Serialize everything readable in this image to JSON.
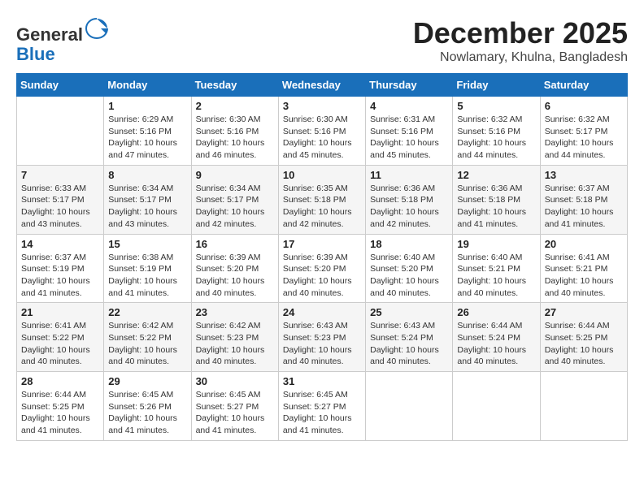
{
  "header": {
    "logo_general": "General",
    "logo_blue": "Blue",
    "month_title": "December 2025",
    "location": "Nowlamary, Khulna, Bangladesh"
  },
  "weekdays": [
    "Sunday",
    "Monday",
    "Tuesday",
    "Wednesday",
    "Thursday",
    "Friday",
    "Saturday"
  ],
  "weeks": [
    [
      {
        "day": "",
        "sunrise": "",
        "sunset": "",
        "daylight": ""
      },
      {
        "day": "1",
        "sunrise": "Sunrise: 6:29 AM",
        "sunset": "Sunset: 5:16 PM",
        "daylight": "Daylight: 10 hours and 47 minutes."
      },
      {
        "day": "2",
        "sunrise": "Sunrise: 6:30 AM",
        "sunset": "Sunset: 5:16 PM",
        "daylight": "Daylight: 10 hours and 46 minutes."
      },
      {
        "day": "3",
        "sunrise": "Sunrise: 6:30 AM",
        "sunset": "Sunset: 5:16 PM",
        "daylight": "Daylight: 10 hours and 45 minutes."
      },
      {
        "day": "4",
        "sunrise": "Sunrise: 6:31 AM",
        "sunset": "Sunset: 5:16 PM",
        "daylight": "Daylight: 10 hours and 45 minutes."
      },
      {
        "day": "5",
        "sunrise": "Sunrise: 6:32 AM",
        "sunset": "Sunset: 5:16 PM",
        "daylight": "Daylight: 10 hours and 44 minutes."
      },
      {
        "day": "6",
        "sunrise": "Sunrise: 6:32 AM",
        "sunset": "Sunset: 5:17 PM",
        "daylight": "Daylight: 10 hours and 44 minutes."
      }
    ],
    [
      {
        "day": "7",
        "sunrise": "Sunrise: 6:33 AM",
        "sunset": "Sunset: 5:17 PM",
        "daylight": "Daylight: 10 hours and 43 minutes."
      },
      {
        "day": "8",
        "sunrise": "Sunrise: 6:34 AM",
        "sunset": "Sunset: 5:17 PM",
        "daylight": "Daylight: 10 hours and 43 minutes."
      },
      {
        "day": "9",
        "sunrise": "Sunrise: 6:34 AM",
        "sunset": "Sunset: 5:17 PM",
        "daylight": "Daylight: 10 hours and 42 minutes."
      },
      {
        "day": "10",
        "sunrise": "Sunrise: 6:35 AM",
        "sunset": "Sunset: 5:18 PM",
        "daylight": "Daylight: 10 hours and 42 minutes."
      },
      {
        "day": "11",
        "sunrise": "Sunrise: 6:36 AM",
        "sunset": "Sunset: 5:18 PM",
        "daylight": "Daylight: 10 hours and 42 minutes."
      },
      {
        "day": "12",
        "sunrise": "Sunrise: 6:36 AM",
        "sunset": "Sunset: 5:18 PM",
        "daylight": "Daylight: 10 hours and 41 minutes."
      },
      {
        "day": "13",
        "sunrise": "Sunrise: 6:37 AM",
        "sunset": "Sunset: 5:18 PM",
        "daylight": "Daylight: 10 hours and 41 minutes."
      }
    ],
    [
      {
        "day": "14",
        "sunrise": "Sunrise: 6:37 AM",
        "sunset": "Sunset: 5:19 PM",
        "daylight": "Daylight: 10 hours and 41 minutes."
      },
      {
        "day": "15",
        "sunrise": "Sunrise: 6:38 AM",
        "sunset": "Sunset: 5:19 PM",
        "daylight": "Daylight: 10 hours and 41 minutes."
      },
      {
        "day": "16",
        "sunrise": "Sunrise: 6:39 AM",
        "sunset": "Sunset: 5:20 PM",
        "daylight": "Daylight: 10 hours and 40 minutes."
      },
      {
        "day": "17",
        "sunrise": "Sunrise: 6:39 AM",
        "sunset": "Sunset: 5:20 PM",
        "daylight": "Daylight: 10 hours and 40 minutes."
      },
      {
        "day": "18",
        "sunrise": "Sunrise: 6:40 AM",
        "sunset": "Sunset: 5:20 PM",
        "daylight": "Daylight: 10 hours and 40 minutes."
      },
      {
        "day": "19",
        "sunrise": "Sunrise: 6:40 AM",
        "sunset": "Sunset: 5:21 PM",
        "daylight": "Daylight: 10 hours and 40 minutes."
      },
      {
        "day": "20",
        "sunrise": "Sunrise: 6:41 AM",
        "sunset": "Sunset: 5:21 PM",
        "daylight": "Daylight: 10 hours and 40 minutes."
      }
    ],
    [
      {
        "day": "21",
        "sunrise": "Sunrise: 6:41 AM",
        "sunset": "Sunset: 5:22 PM",
        "daylight": "Daylight: 10 hours and 40 minutes."
      },
      {
        "day": "22",
        "sunrise": "Sunrise: 6:42 AM",
        "sunset": "Sunset: 5:22 PM",
        "daylight": "Daylight: 10 hours and 40 minutes."
      },
      {
        "day": "23",
        "sunrise": "Sunrise: 6:42 AM",
        "sunset": "Sunset: 5:23 PM",
        "daylight": "Daylight: 10 hours and 40 minutes."
      },
      {
        "day": "24",
        "sunrise": "Sunrise: 6:43 AM",
        "sunset": "Sunset: 5:23 PM",
        "daylight": "Daylight: 10 hours and 40 minutes."
      },
      {
        "day": "25",
        "sunrise": "Sunrise: 6:43 AM",
        "sunset": "Sunset: 5:24 PM",
        "daylight": "Daylight: 10 hours and 40 minutes."
      },
      {
        "day": "26",
        "sunrise": "Sunrise: 6:44 AM",
        "sunset": "Sunset: 5:24 PM",
        "daylight": "Daylight: 10 hours and 40 minutes."
      },
      {
        "day": "27",
        "sunrise": "Sunrise: 6:44 AM",
        "sunset": "Sunset: 5:25 PM",
        "daylight": "Daylight: 10 hours and 40 minutes."
      }
    ],
    [
      {
        "day": "28",
        "sunrise": "Sunrise: 6:44 AM",
        "sunset": "Sunset: 5:25 PM",
        "daylight": "Daylight: 10 hours and 41 minutes."
      },
      {
        "day": "29",
        "sunrise": "Sunrise: 6:45 AM",
        "sunset": "Sunset: 5:26 PM",
        "daylight": "Daylight: 10 hours and 41 minutes."
      },
      {
        "day": "30",
        "sunrise": "Sunrise: 6:45 AM",
        "sunset": "Sunset: 5:27 PM",
        "daylight": "Daylight: 10 hours and 41 minutes."
      },
      {
        "day": "31",
        "sunrise": "Sunrise: 6:45 AM",
        "sunset": "Sunset: 5:27 PM",
        "daylight": "Daylight: 10 hours and 41 minutes."
      },
      {
        "day": "",
        "sunrise": "",
        "sunset": "",
        "daylight": ""
      },
      {
        "day": "",
        "sunrise": "",
        "sunset": "",
        "daylight": ""
      },
      {
        "day": "",
        "sunrise": "",
        "sunset": "",
        "daylight": ""
      }
    ]
  ]
}
